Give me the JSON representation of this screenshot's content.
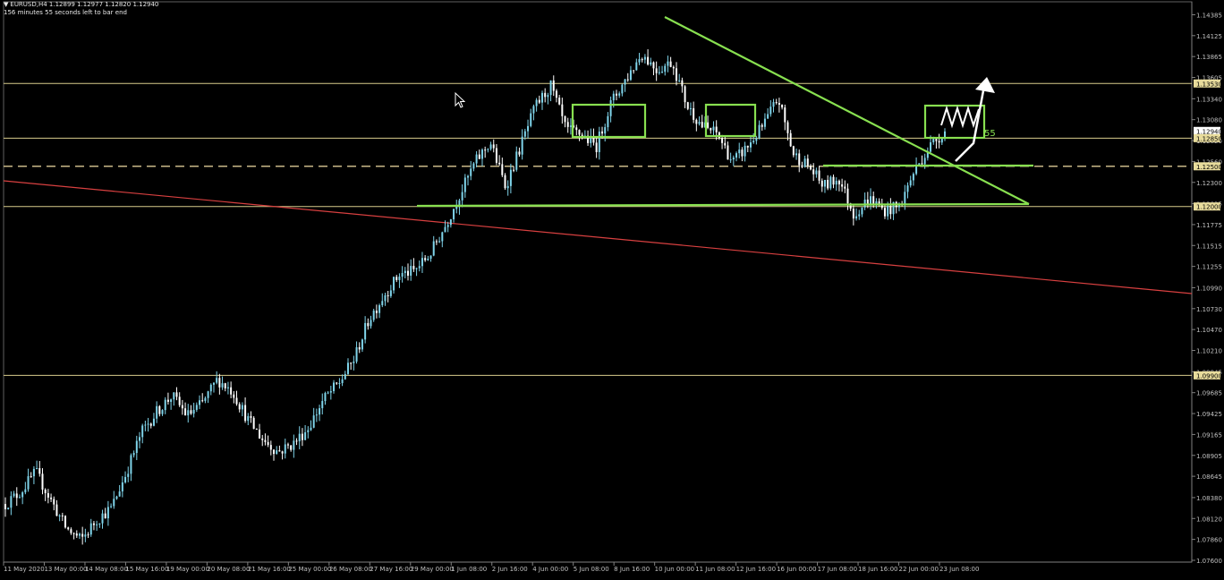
{
  "header": {
    "symbol_info": "EURUSD,H4  1.12899 1.12977 1.12820 1.12940",
    "timer": "156 minutes 55 seconds left to bar end"
  },
  "colors": {
    "background": "#000000",
    "bull_candle": "#7fd4ea",
    "bear_candle": "#ffffff",
    "horizontal_level": "#d8cc8c",
    "dashed_level": "#c8b888",
    "trend_line_red": "#d84040",
    "annotation_green": "#88e050",
    "annotation_white": "#ffffff",
    "axis_text": "#c0c0c0"
  },
  "price_axis": {
    "ticks": [
      "1.14385",
      "1.14125",
      "1.13865",
      "1.13605",
      "1.13340",
      "1.13080",
      "1.12820",
      "1.12560",
      "1.12300",
      "1.12035",
      "1.11775",
      "1.11515",
      "1.11255",
      "1.10990",
      "1.10730",
      "1.10470",
      "1.10210",
      "1.09945",
      "1.09685",
      "1.09425",
      "1.09165",
      "1.08905",
      "1.08645",
      "1.08380",
      "1.08120",
      "1.07860",
      "1.07600"
    ],
    "level_labels": [
      "1.13530",
      "1.12940",
      "1.12850",
      "1.12500",
      "1.12000",
      "1.09900"
    ],
    "bid_label": "1.12940"
  },
  "time_axis": {
    "labels": [
      "11 May 2020",
      "13 May 00:00",
      "14 May 08:00",
      "15 May 16:00",
      "19 May 00:00",
      "20 May 08:00",
      "21 May 16:00",
      "25 May 00:00",
      "26 May 08:00",
      "27 May 16:00",
      "29 May 00:00",
      "1 Jun 08:00",
      "2 Jun 16:00",
      "4 Jun 00:00",
      "5 Jun 08:00",
      "8 Jun 16:00",
      "10 Jun 00:00",
      "11 Jun 08:00",
      "12 Jun 16:00",
      "16 Jun 00:00",
      "17 Jun 08:00",
      "18 Jun 16:00",
      "22 Jun 00:00",
      "23 Jun 08:00"
    ]
  },
  "chart_data": {
    "type": "candlestick",
    "title": "",
    "symbol": "EURUSD",
    "timeframe": "H4",
    "ylim": [
      1.076,
      1.1439
    ],
    "horizontal_levels": [
      1.1353,
      1.1285,
      1.125,
      1.12,
      1.099
    ],
    "dashed_levels": [
      1.125
    ],
    "close_path": [
      1.083,
      1.0845,
      1.087,
      1.0835,
      1.08,
      1.0785,
      1.081,
      1.0825,
      1.087,
      1.092,
      1.0945,
      1.0965,
      1.094,
      1.0955,
      1.0985,
      1.097,
      1.0935,
      1.091,
      1.0895,
      1.0905,
      1.0925,
      1.096,
      1.098,
      1.101,
      1.106,
      1.109,
      1.1115,
      1.112,
      1.114,
      1.1175,
      1.1215,
      1.1255,
      1.128,
      1.1225,
      1.1275,
      1.1325,
      1.135,
      1.1295,
      1.129,
      1.1275,
      1.133,
      1.136,
      1.139,
      1.137,
      1.138,
      1.1325,
      1.13,
      1.129,
      1.1255,
      1.1275,
      1.13,
      1.1335,
      1.1265,
      1.125,
      1.1225,
      1.1235,
      1.119,
      1.121,
      1.1195,
      1.12,
      1.1245,
      1.1275,
      1.1294
    ]
  }
}
